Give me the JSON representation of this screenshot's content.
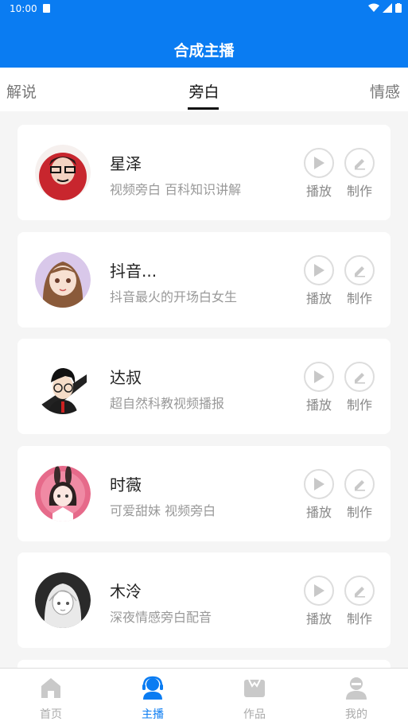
{
  "status_bar": {
    "time": "10:00"
  },
  "header": {
    "title": "合成主播"
  },
  "tabs": [
    {
      "label": "解说"
    },
    {
      "label": "旁白",
      "selected": true
    },
    {
      "label": "情感"
    }
  ],
  "anchors": [
    {
      "name": "星泽",
      "description": "视频旁白  百科知识讲解",
      "play_label": "播放",
      "make_label": "制作"
    },
    {
      "name": "抖音...",
      "description": "抖音最火的开场白女生",
      "play_label": "播放",
      "make_label": "制作"
    },
    {
      "name": "达叔",
      "description": "超自然科教视频播报",
      "play_label": "播放",
      "make_label": "制作"
    },
    {
      "name": "时薇",
      "description": "可爱甜妹  视频旁白",
      "play_label": "播放",
      "make_label": "制作"
    },
    {
      "name": "木泠",
      "description": "深夜情感旁白配音",
      "play_label": "播放",
      "make_label": "制作"
    }
  ],
  "bottom_nav": [
    {
      "label": "首页",
      "icon": "home-icon"
    },
    {
      "label": "主播",
      "icon": "anchor-icon",
      "active": true
    },
    {
      "label": "作品",
      "icon": "works-icon"
    },
    {
      "label": "我的",
      "icon": "profile-icon"
    }
  ],
  "colors": {
    "brand_blue": "#0a7cf2",
    "inactive_gray": "#aaaaaa"
  }
}
